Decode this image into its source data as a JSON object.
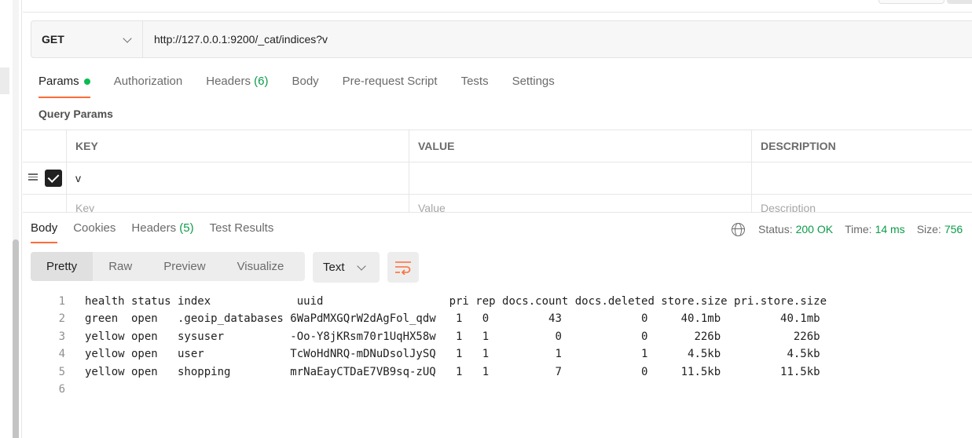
{
  "request": {
    "method": "GET",
    "url": "http://127.0.0.1:9200/_cat/indices?v",
    "tabs": [
      {
        "label": "Params",
        "active": true,
        "dot": true
      },
      {
        "label": "Authorization"
      },
      {
        "label": "Headers",
        "count": "(6)"
      },
      {
        "label": "Body"
      },
      {
        "label": "Pre-request Script"
      },
      {
        "label": "Tests"
      },
      {
        "label": "Settings"
      }
    ]
  },
  "query_params": {
    "title": "Query Params",
    "columns": [
      "KEY",
      "VALUE",
      "DESCRIPTION"
    ],
    "rows": [
      {
        "key": "v",
        "value": "",
        "description": "",
        "checked": true
      }
    ],
    "placeholders": {
      "key": "Key",
      "value": "Value",
      "description": "Description"
    }
  },
  "response": {
    "tabs": [
      {
        "label": "Body",
        "active": true
      },
      {
        "label": "Cookies"
      },
      {
        "label": "Headers",
        "count": "(5)"
      },
      {
        "label": "Test Results"
      }
    ],
    "status_label": "Status:",
    "status_value": "200 OK",
    "time_label": "Time:",
    "time_value": "14 ms",
    "size_label": "Size:",
    "size_value": "756",
    "view_tabs": [
      "Pretty",
      "Raw",
      "Preview",
      "Visualize"
    ],
    "language": "Text",
    "lines": [
      {
        "n": "1",
        "text": "health status index             uuid                   pri rep docs.count docs.deleted store.size pri.store.size"
      },
      {
        "n": "2",
        "text": "green  open   .geoip_databases 6WaPdMXGQrW2dAgFol_qdw   1   0         43            0     40.1mb         40.1mb"
      },
      {
        "n": "3",
        "text": "yellow open   sysuser          -Oo-Y8jKRsm70r1UqHX58w   1   1          0            0       226b           226b"
      },
      {
        "n": "4",
        "text": "yellow open   user             TcWoHdNRQ-mDNuDsolJySQ   1   1          1            1      4.5kb          4.5kb"
      },
      {
        "n": "5",
        "text": "yellow open   shopping         mrNaEayCTDaE7VB9sq-zUQ   1   1          7            0     11.5kb         11.5kb"
      },
      {
        "n": "6",
        "text": ""
      }
    ]
  },
  "colors": {
    "accent": "#ff6c37",
    "success": "#0c9b48",
    "dot": "#0cbb52"
  }
}
